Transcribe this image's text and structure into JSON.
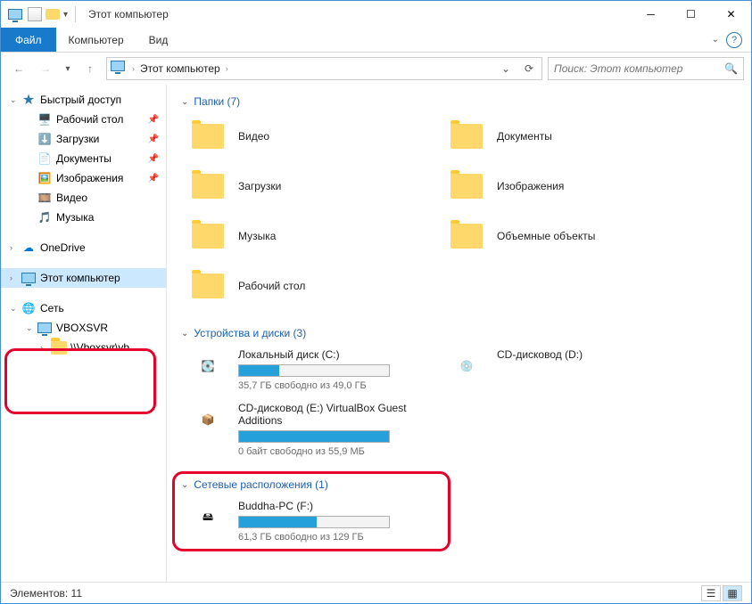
{
  "titlebar": {
    "title": "Этот компьютер"
  },
  "ribbon": {
    "file": "Файл",
    "tabs": [
      "Компьютер",
      "Вид"
    ]
  },
  "address": {
    "crumb": "Этот компьютер",
    "search_placeholder": "Поиск: Этот компьютер"
  },
  "nav": {
    "quick": {
      "label": "Быстрый доступ",
      "items": [
        {
          "label": "Рабочий стол",
          "pinned": true
        },
        {
          "label": "Загрузки",
          "pinned": true
        },
        {
          "label": "Документы",
          "pinned": true
        },
        {
          "label": "Изображения",
          "pinned": true
        },
        {
          "label": "Видео",
          "pinned": false
        },
        {
          "label": "Музыка",
          "pinned": false
        }
      ]
    },
    "onedrive": "OneDrive",
    "thispc": "Этот компьютер",
    "network": {
      "label": "Сеть",
      "host": "VBOXSVR",
      "share": "\\\\Vboxsvr\\vb"
    }
  },
  "sections": {
    "folders": {
      "title": "Папки (7)",
      "items": [
        "Видео",
        "Документы",
        "Загрузки",
        "Изображения",
        "Музыка",
        "Объемные объекты",
        "Рабочий стол"
      ]
    },
    "drives": {
      "title": "Устройства и диски (3)",
      "items": [
        {
          "name": "Локальный диск (C:)",
          "sub": "35,7 ГБ свободно из 49,0 ГБ",
          "fill": 27,
          "icon": "hdd"
        },
        {
          "name": "CD-дисковод (D:)",
          "sub": "",
          "fill": null,
          "icon": "cd"
        },
        {
          "name": "CD-дисковод (E:) VirtualBox Guest Additions",
          "sub": "0 байт свободно из 55,9 МБ",
          "fill": 100,
          "icon": "vbox"
        }
      ]
    },
    "netloc": {
      "title": "Сетевые расположения (1)",
      "items": [
        {
          "name": "Buddha-PC (F:)",
          "sub": "61,3 ГБ свободно из 129 ГБ",
          "fill": 52
        }
      ]
    }
  },
  "status": {
    "text": "Элементов: 11"
  }
}
